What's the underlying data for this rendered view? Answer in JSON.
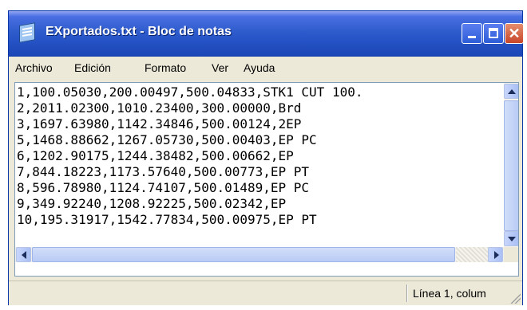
{
  "window": {
    "title": "EXportados.txt - Bloc de notas",
    "icon": "notepad-icon"
  },
  "title_buttons": {
    "minimize_icon": "minimize-icon",
    "maximize_icon": "maximize-icon",
    "close_glyph": "✕"
  },
  "menu": {
    "items": [
      "Archivo",
      "Edición",
      "Formato",
      "Ver",
      "Ayuda"
    ]
  },
  "editor": {
    "lines": [
      "1,100.05030,200.00497,500.04833,STK1 CUT 100.",
      "2,2011.02300,1010.23400,300.00000,Brd",
      "3,1697.63980,1142.34846,500.00124,2EP",
      "5,1468.88662,1267.05730,500.00403,EP PC",
      "6,1202.90175,1244.38482,500.00662,EP",
      "7,844.18223,1173.57640,500.00773,EP PT",
      "8,596.78980,1124.74107,500.01489,EP PC",
      "9,349.92240,1208.92225,500.02342,EP",
      "10,195.31917,1542.77834,500.00975,EP PT"
    ]
  },
  "statusbar": {
    "position_text": "Línea 1, colum"
  },
  "colors": {
    "titlebar": "#2451c3",
    "window_frame": "#0b3aa8",
    "chrome": "#ece9d8",
    "scrollbar": "#b9cbf5"
  }
}
